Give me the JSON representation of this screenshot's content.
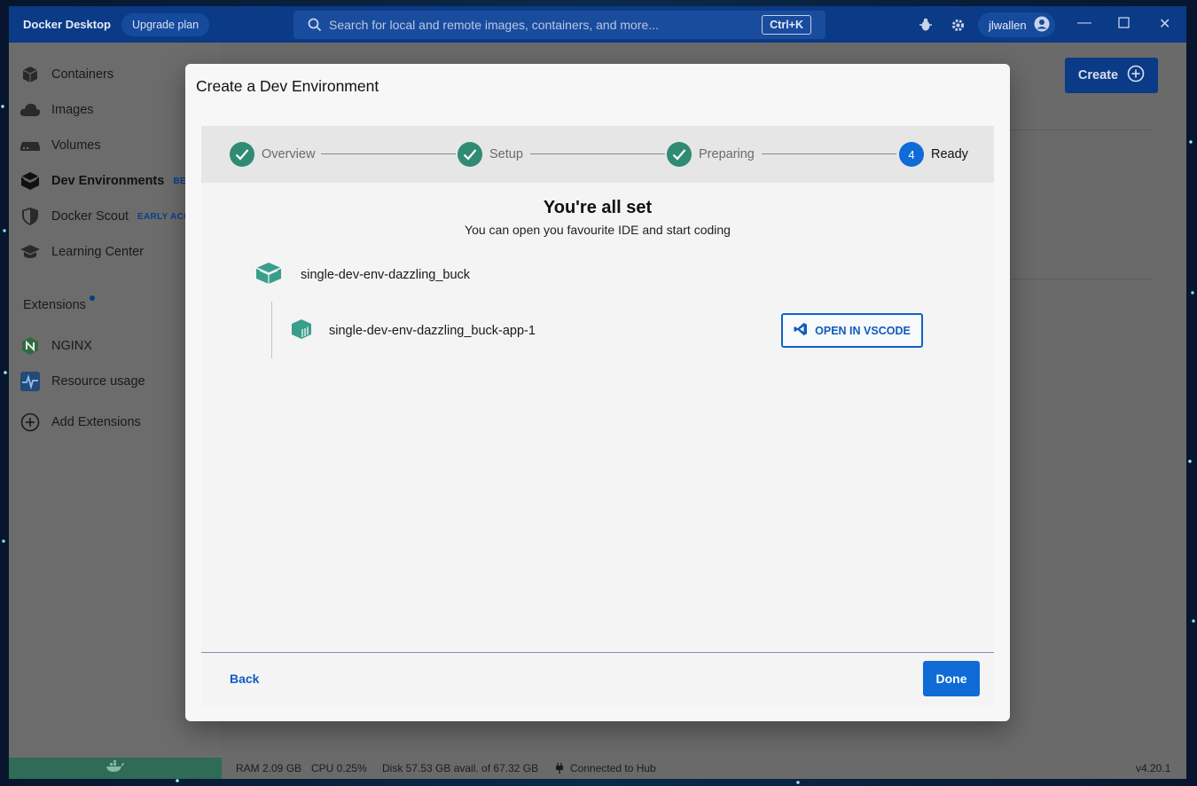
{
  "titlebar": {
    "app_name": "Docker Desktop",
    "upgrade_label": "Upgrade plan",
    "search_placeholder": "Search for local and remote images, containers, and more...",
    "search_shortcut": "Ctrl+K",
    "username": "jlwallen"
  },
  "sidebar": {
    "items": [
      {
        "label": "Containers",
        "icon": "containers-icon"
      },
      {
        "label": "Images",
        "icon": "images-icon"
      },
      {
        "label": "Volumes",
        "icon": "volumes-icon"
      },
      {
        "label": "Dev Environments",
        "icon": "dev-environments-icon",
        "tag": "BETA",
        "active": true
      },
      {
        "label": "Docker Scout",
        "icon": "shield-icon",
        "tag": "EARLY ACC"
      },
      {
        "label": "Learning Center",
        "icon": "graduation-cap-icon"
      }
    ],
    "extensions_title": "Extensions",
    "extensions": [
      {
        "label": "NGINX",
        "icon": "nginx-icon"
      },
      {
        "label": "Resource usage",
        "icon": "pulse-icon"
      }
    ],
    "add_extensions_label": "Add Extensions"
  },
  "main": {
    "create_label": "Create"
  },
  "statusbar": {
    "ram": "RAM 2.09 GB",
    "cpu": "CPU 0.25%",
    "disk": "Disk 57.53 GB avail. of 67.32 GB",
    "hub": "Connected to Hub",
    "version": "v4.20.1"
  },
  "modal": {
    "title": "Create a Dev Environment",
    "steps": [
      {
        "label": "Overview",
        "state": "complete"
      },
      {
        "label": "Setup",
        "state": "complete"
      },
      {
        "label": "Preparing",
        "state": "complete"
      },
      {
        "label": "Ready",
        "state": "active",
        "number": "4"
      }
    ],
    "heading": "You're all set",
    "subheading": "You can open you favourite IDE and start coding",
    "environment_name": "single-dev-env-dazzling_buck",
    "service_name": "single-dev-env-dazzling_buck-app-1",
    "open_vscode_label": "OPEN IN VSCODE",
    "back_label": "Back",
    "done_label": "Done"
  },
  "colors": {
    "titlebar": "#0b3a86",
    "accent": "#0f6bd6",
    "step_complete": "#2f8b74",
    "env_icon": "#3a9e8c"
  }
}
